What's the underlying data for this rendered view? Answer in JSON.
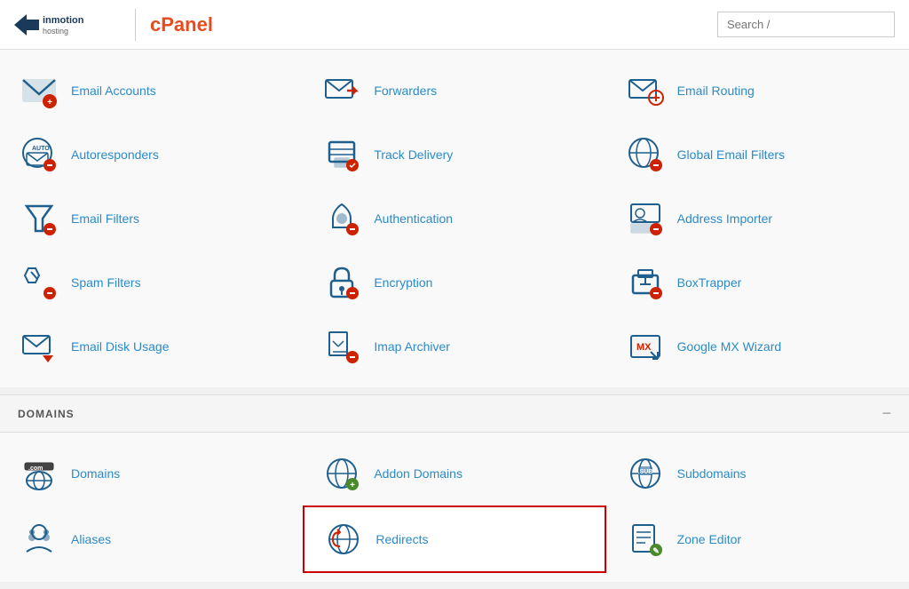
{
  "header": {
    "brand": "inmotion\nhosting",
    "cpanel": "cPanel",
    "search_placeholder": "Search /"
  },
  "email_section": {
    "items": [
      {
        "id": "email-accounts",
        "label": "Email Accounts"
      },
      {
        "id": "forwarders",
        "label": "Forwarders"
      },
      {
        "id": "email-routing",
        "label": "Email Routing"
      },
      {
        "id": "autoresponders",
        "label": "Autoresponders"
      },
      {
        "id": "track-delivery",
        "label": "Track Delivery"
      },
      {
        "id": "global-email-filters",
        "label": "Global Email Filters"
      },
      {
        "id": "email-filters",
        "label": "Email Filters"
      },
      {
        "id": "authentication",
        "label": "Authentication"
      },
      {
        "id": "address-importer",
        "label": "Address Importer"
      },
      {
        "id": "spam-filters",
        "label": "Spam Filters"
      },
      {
        "id": "encryption",
        "label": "Encryption"
      },
      {
        "id": "boxtrapper",
        "label": "BoxTrapper"
      },
      {
        "id": "email-disk-usage",
        "label": "Email Disk Usage"
      },
      {
        "id": "imap-archiver",
        "label": "Imap Archiver"
      },
      {
        "id": "google-mx-wizard",
        "label": "Google MX Wizard"
      }
    ]
  },
  "domains_section": {
    "title": "DOMAINS",
    "items": [
      {
        "id": "domains",
        "label": "Domains"
      },
      {
        "id": "addon-domains",
        "label": "Addon Domains"
      },
      {
        "id": "subdomains",
        "label": "Subdomains"
      },
      {
        "id": "aliases",
        "label": "Aliases"
      },
      {
        "id": "redirects",
        "label": "Redirects",
        "highlighted": true
      },
      {
        "id": "zone-editor",
        "label": "Zone Editor"
      }
    ]
  }
}
